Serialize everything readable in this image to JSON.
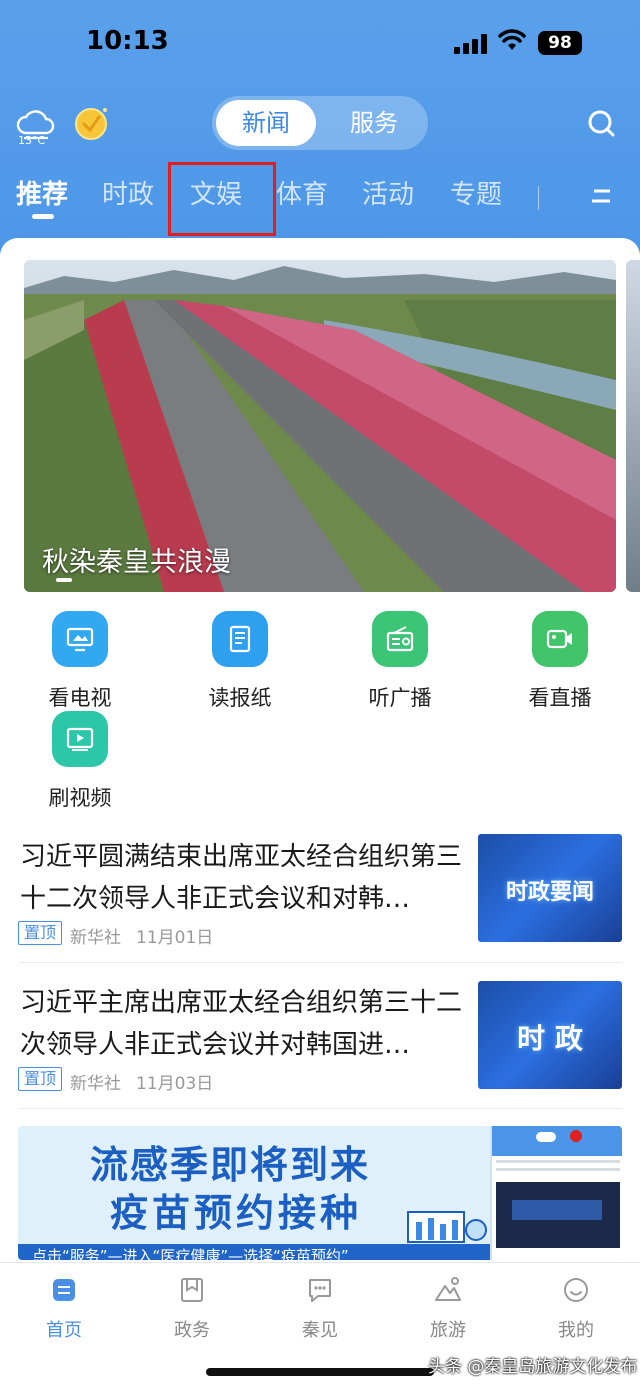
{
  "status_bar": {
    "time": "10:13",
    "battery": "98"
  },
  "header": {
    "weather_temp": "13°C",
    "segments": {
      "news": "新闻",
      "service": "服务"
    }
  },
  "tabs": [
    "推荐",
    "时政",
    "文娱",
    "体育",
    "活动",
    "专题"
  ],
  "active_tab": "推荐",
  "banner": {
    "title": "秋染秦皇共浪漫"
  },
  "quick_entries": [
    {
      "label": "看电视",
      "icon": "tv-icon",
      "color": "#32a8f0"
    },
    {
      "label": "读报纸",
      "icon": "newspaper-icon",
      "color": "#2f9ff0"
    },
    {
      "label": "听广播",
      "icon": "radio-icon",
      "color": "#3cc477"
    },
    {
      "label": "看直播",
      "icon": "live-camera-icon",
      "color": "#41c46a"
    },
    {
      "label": "刷视频",
      "icon": "video-icon",
      "color": "#2cc7a8"
    }
  ],
  "news": [
    {
      "title": "习近平圆满结束出席亚太经合组织第三十二次领导人非正式会议和对韩…",
      "badge": "置顶",
      "source": "新华社",
      "date": "11月01日",
      "thumb_text": "时政要闻"
    },
    {
      "title": "习近平主席出席亚太经合组织第三十二次领导人非正式会议并对韩国进…",
      "badge": "置顶",
      "source": "新华社",
      "date": "11月03日",
      "thumb_text": "时 政"
    }
  ],
  "ad": {
    "line1": "流感季即将到来",
    "line2": "疫苗预约接种",
    "footer": "点击“服务”—进入“医疗健康”—选择“疫苗预约”"
  },
  "bottom_nav": [
    {
      "label": "首页",
      "icon": "home-icon",
      "active": true
    },
    {
      "label": "政务",
      "icon": "government-icon",
      "active": false
    },
    {
      "label": "秦见",
      "icon": "chat-icon",
      "active": false
    },
    {
      "label": "旅游",
      "icon": "travel-icon",
      "active": false
    },
    {
      "label": "我的",
      "icon": "profile-icon",
      "active": false
    }
  ],
  "watermark": "头条 @秦皇岛旅游文化发布",
  "colors": {
    "header_blue": "#4b95e8",
    "accent_blue": "#4b8fe4",
    "highlight_red": "#e0201e"
  }
}
